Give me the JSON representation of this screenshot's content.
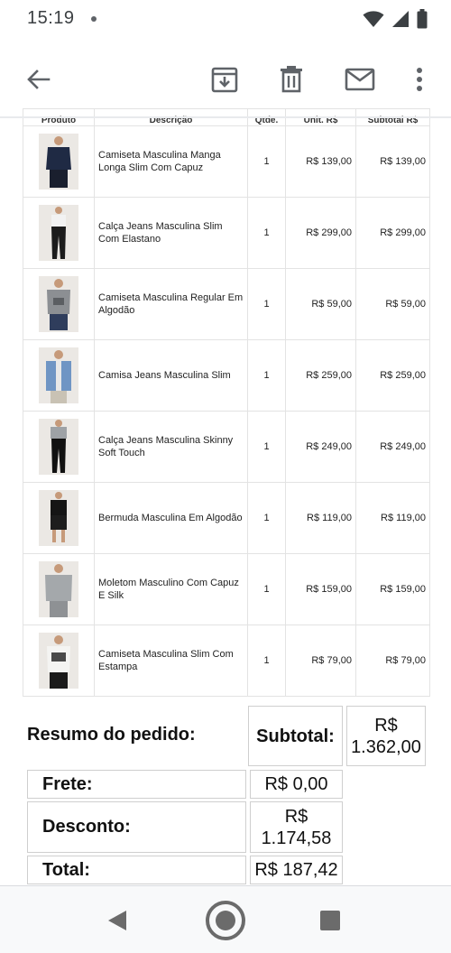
{
  "status_bar": {
    "time": "15:19",
    "icons": [
      "wifi-icon",
      "cellular-signal-icon",
      "battery-icon"
    ]
  },
  "toolbar": {
    "icons": [
      "back-arrow-icon",
      "archive-icon",
      "delete-icon",
      "mail-icon",
      "more-vert-icon"
    ]
  },
  "table": {
    "headers": {
      "produto": "Produto",
      "descricao": "Descrição",
      "qtde": "Qtde.",
      "unit": "Unit. R$",
      "subtotal": "Subtotal R$"
    },
    "rows": [
      {
        "description": "Camiseta Masculina Manga Longa Slim Com Capuz",
        "qty": "1",
        "unit": "R$ 139,00",
        "subtotal": "R$ 139,00"
      },
      {
        "description": "Calça Jeans Masculina Slim Com Elastano",
        "qty": "1",
        "unit": "R$ 299,00",
        "subtotal": "R$ 299,00"
      },
      {
        "description": "Camiseta Masculina Regular Em Algodão",
        "qty": "1",
        "unit": "R$ 59,00",
        "subtotal": "R$ 59,00"
      },
      {
        "description": "Camisa Jeans Masculina Slim",
        "qty": "1",
        "unit": "R$ 259,00",
        "subtotal": "R$ 259,00"
      },
      {
        "description": "Calça Jeans Masculina Skinny Soft Touch",
        "qty": "1",
        "unit": "R$ 249,00",
        "subtotal": "R$ 249,00"
      },
      {
        "description": "Bermuda Masculina Em Algodão",
        "qty": "1",
        "unit": "R$ 119,00",
        "subtotal": "R$ 119,00"
      },
      {
        "description": "Moletom Masculino Com Capuz E Silk",
        "qty": "1",
        "unit": "R$ 159,00",
        "subtotal": "R$ 159,00"
      },
      {
        "description": "Camiseta Masculina Slim Com Estampa",
        "qty": "1",
        "unit": "R$ 79,00",
        "subtotal": "R$ 79,00"
      }
    ]
  },
  "summary": {
    "title": "Resumo do pedido:",
    "subtotal_label": "Subtotal:",
    "subtotal_value_line1": "R$",
    "subtotal_value_line2": "1.362,00",
    "frete_label": "Frete:",
    "frete_value": "R$ 0,00",
    "desconto_label": "Desconto:",
    "desconto_value_line1": "R$",
    "desconto_value_line2": "1.174,58",
    "total_label": "Total:",
    "total_value": "R$ 187,42"
  },
  "nav_bar": {
    "icons": [
      "nav-back-icon",
      "nav-home-icon",
      "nav-recents-icon"
    ]
  },
  "colors": {
    "icon_gray": "#5f6368",
    "border": "#e3e3e3",
    "nav_bg": "#f8f9fa"
  }
}
